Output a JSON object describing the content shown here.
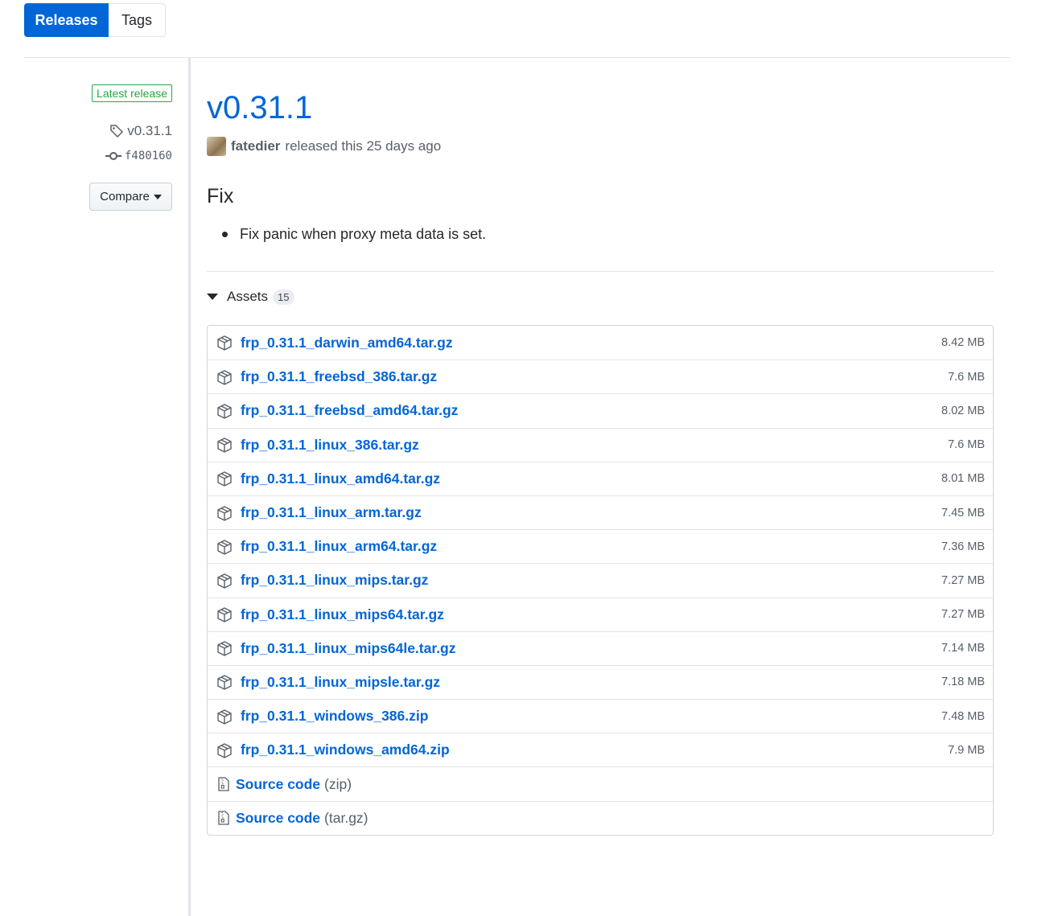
{
  "tabs": [
    {
      "label": "Releases",
      "active": true
    },
    {
      "label": "Tags",
      "active": false
    }
  ],
  "sidebar": {
    "latest_label": "Latest release",
    "tag": "v0.31.1",
    "commit": "f480160",
    "compare_label": "Compare",
    "icons": {
      "tag": "tag-icon",
      "commit": "commit-icon"
    }
  },
  "release": {
    "title": "v0.31.1",
    "author": "fatedier",
    "released_text": "released this 25 days ago",
    "heading": "Fix",
    "notes": [
      "Fix panic when proxy meta data is set."
    ]
  },
  "assets": {
    "label": "Assets",
    "count": "15",
    "files": [
      {
        "name": "frp_0.31.1_darwin_amd64.tar.gz",
        "size": "8.42 MB"
      },
      {
        "name": "frp_0.31.1_freebsd_386.tar.gz",
        "size": "7.6 MB"
      },
      {
        "name": "frp_0.31.1_freebsd_amd64.tar.gz",
        "size": "8.02 MB"
      },
      {
        "name": "frp_0.31.1_linux_386.tar.gz",
        "size": "7.6 MB"
      },
      {
        "name": "frp_0.31.1_linux_amd64.tar.gz",
        "size": "8.01 MB"
      },
      {
        "name": "frp_0.31.1_linux_arm.tar.gz",
        "size": "7.45 MB"
      },
      {
        "name": "frp_0.31.1_linux_arm64.tar.gz",
        "size": "7.36 MB"
      },
      {
        "name": "frp_0.31.1_linux_mips.tar.gz",
        "size": "7.27 MB"
      },
      {
        "name": "frp_0.31.1_linux_mips64.tar.gz",
        "size": "7.27 MB"
      },
      {
        "name": "frp_0.31.1_linux_mips64le.tar.gz",
        "size": "7.14 MB"
      },
      {
        "name": "frp_0.31.1_linux_mipsle.tar.gz",
        "size": "7.18 MB"
      },
      {
        "name": "frp_0.31.1_windows_386.zip",
        "size": "7.48 MB"
      },
      {
        "name": "frp_0.31.1_windows_amd64.zip",
        "size": "7.9 MB"
      }
    ],
    "source": [
      {
        "label": "Source code",
        "format": "(zip)"
      },
      {
        "label": "Source code",
        "format": "(tar.gz)"
      }
    ]
  },
  "colors": {
    "accent": "#0366d6",
    "latest_green": "#28a745",
    "muted": "#586069"
  }
}
